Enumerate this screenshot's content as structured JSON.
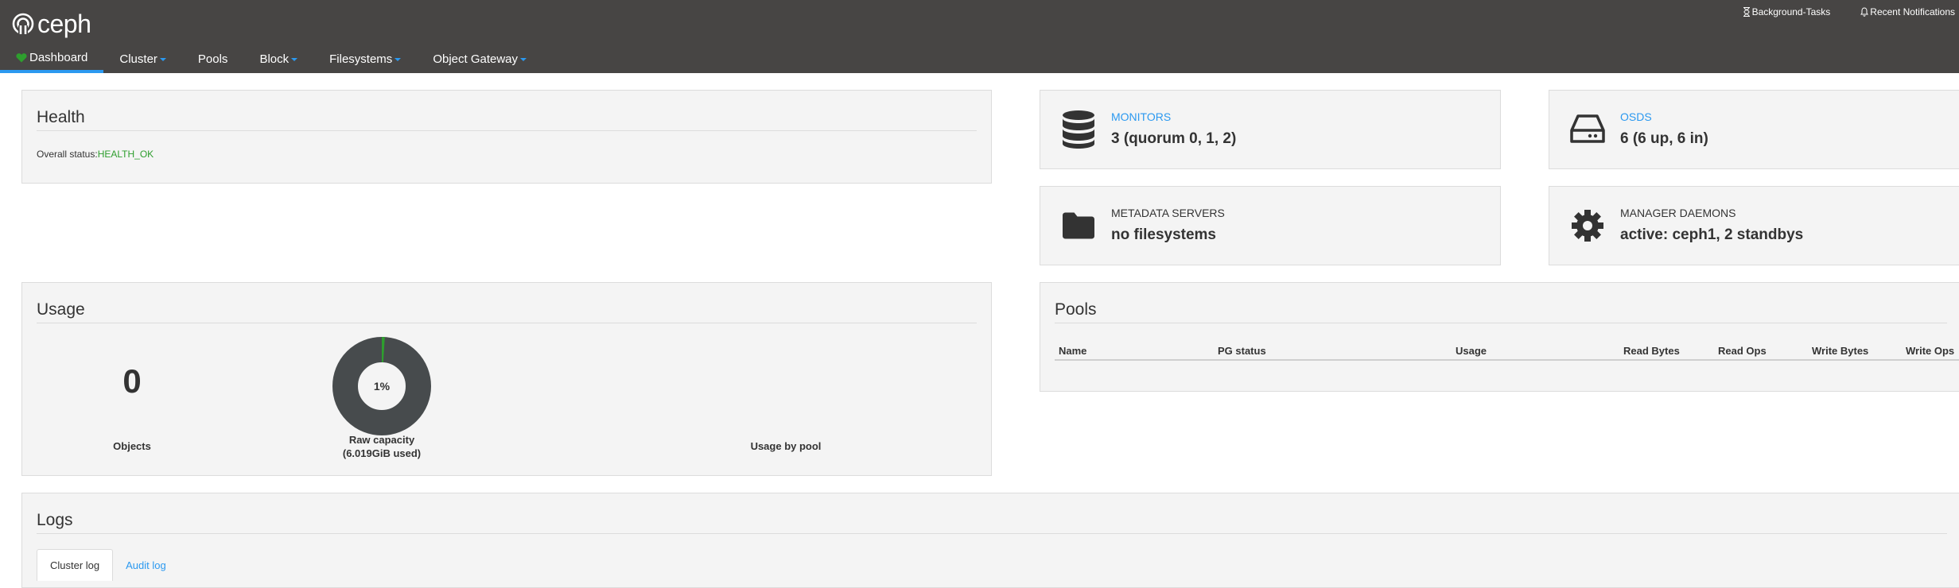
{
  "brand": {
    "name": "ceph"
  },
  "util_nav": [
    {
      "label": "Background-Tasks",
      "icon": "hourglass-icon"
    },
    {
      "label": "Recent Notifications",
      "icon": "bell-icon"
    }
  ],
  "nav": [
    {
      "label": "Dashboard",
      "icon": "heart-icon",
      "active": true
    },
    {
      "label": "Cluster",
      "dropdown": true
    },
    {
      "label": "Pools"
    },
    {
      "label": "Block",
      "dropdown": true
    },
    {
      "label": "Filesystems",
      "dropdown": true
    },
    {
      "label": "Object Gateway",
      "dropdown": true
    }
  ],
  "health": {
    "title": "Health",
    "status_label": "Overall status:",
    "status_value": "HEALTH_OK"
  },
  "monitors": {
    "label": "MONITORS",
    "value": "3 (quorum 0, 1, 2)",
    "icon": "database-icon"
  },
  "osds": {
    "label": "OSDS",
    "value": "6 (6 up, 6 in)",
    "icon": "hdd-icon"
  },
  "mds": {
    "label": "METADATA SERVERS",
    "value": "no filesystems",
    "icon": "folder-icon"
  },
  "mgr": {
    "label": "MANAGER DAEMONS",
    "value": "active: ceph1, 2 standbys",
    "icon": "gear-icon"
  },
  "usage": {
    "title": "Usage",
    "objects_value": "0",
    "objects_label": "Objects",
    "raw_capacity_percent": "1%",
    "raw_capacity_label": "Raw capacity",
    "raw_capacity_used": "(6.019GiB used)",
    "usage_by_pool_label": "Usage by pool",
    "used_fraction": 0.01
  },
  "pools": {
    "title": "Pools",
    "columns": [
      "Name",
      "PG status",
      "Usage",
      "Read Bytes",
      "Read Ops",
      "Write Bytes",
      "Write Ops"
    ]
  },
  "logs": {
    "title": "Logs",
    "tabs": [
      {
        "label": "Cluster log",
        "active": true
      },
      {
        "label": "Audit log",
        "active": false
      }
    ]
  },
  "colors": {
    "topbar": "#474544",
    "accent": "#2b99f0",
    "ok": "#2e9e2e",
    "donut_used": "#2e9e2e",
    "donut_free": "#474b4d"
  }
}
